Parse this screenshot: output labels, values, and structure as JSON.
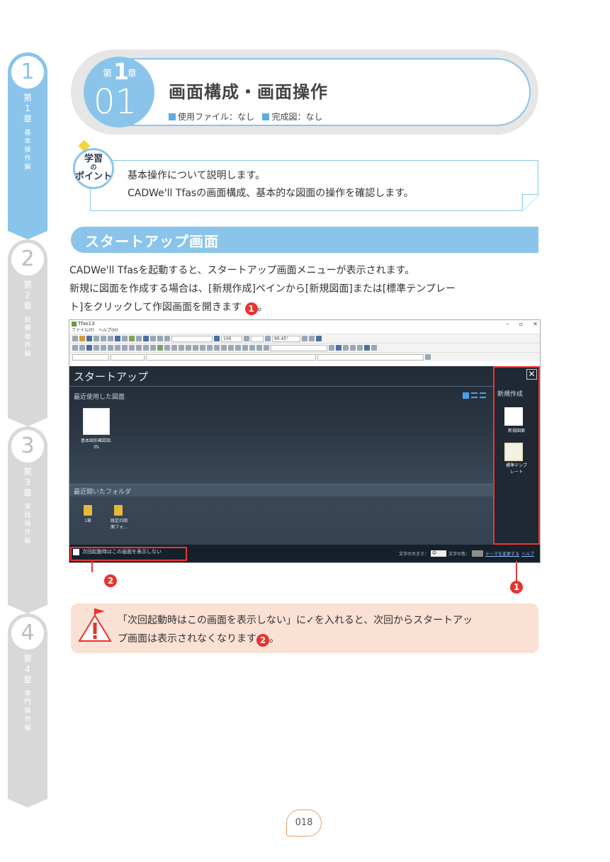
{
  "side_tabs": [
    {
      "num": "1",
      "chapter": [
        "第",
        "1",
        "章"
      ],
      "subtitle": [
        "基",
        "本",
        "操",
        "作",
        "編"
      ]
    },
    {
      "num": "2",
      "chapter": [
        "第",
        "2",
        "章"
      ],
      "subtitle": [
        "設",
        "備",
        "操",
        "作",
        "編"
      ]
    },
    {
      "num": "3",
      "chapter": [
        "第",
        "3",
        "章"
      ],
      "subtitle": [
        "実",
        "践",
        "操",
        "作",
        "編"
      ]
    },
    {
      "num": "4",
      "chapter": [
        "第",
        "4",
        "章"
      ],
      "subtitle": [
        "専",
        "門",
        "操",
        "作",
        "編"
      ]
    }
  ],
  "header": {
    "dai": "第",
    "chapter_num": "1",
    "sho": "章",
    "section_num": "01",
    "title": "画面構成・画面操作",
    "files_label": "使用ファイル：なし",
    "complete_label": "完成図：なし"
  },
  "point": {
    "badge_top": "学習",
    "badge_mid": "の",
    "badge_bottom": "ポイント",
    "line1": "基本操作について説明します。",
    "line2": "CADWe'll Tfasの画面構成、基本的な図面の操作を確認します。"
  },
  "section": {
    "title": "スタートアップ画面",
    "line1": "CADWe'll Tfasを起動すると、スタートアップ画面メニューが表示されます。",
    "line2": "新規に図面を作成する場合は、[新規作成]ペインから[新規図面]または[標準テンプレー",
    "line3": "ト]をクリックして作図画面を開きます",
    "marker": "1"
  },
  "screenshot": {
    "app_title": "Tfas13",
    "menu": "ファイル(F)　ヘルプ(H)",
    "zoom": "100",
    "angle": "90.45°",
    "startup_title": "スタートアップ",
    "recent_label": "最近使用した図面",
    "recent_file_line1": "基本図形確認図.",
    "recent_file_line2": "tfs",
    "folders_label": "最近開いたフォルダ",
    "folder1": "1章",
    "folder2_line1": "既定の図",
    "folder2_line2": "面フォ...",
    "new_label": "新規作成",
    "new_drawing": "新規図面",
    "template_line1": "標準テンプ",
    "template_line2": "レート",
    "close_glyph": "✕",
    "dont_show": "次回起動時はこの画面を表示しない",
    "font_size_label": "文字の大きさ：",
    "font_size_value": "中",
    "font_color_label": "文字の色：",
    "change_theme": "テーマを変更する",
    "help": "ヘルプ",
    "win_min": "–",
    "win_max": "▫",
    "win_close": "✕"
  },
  "callouts": {
    "one": "1",
    "two": "2"
  },
  "note": {
    "line1": "「次回起動時はこの画面を表示しない」に✓を入れると、次回からスタートアッ",
    "line2": "プ画面は表示されなくなります",
    "marker": "2",
    "end": "。"
  },
  "page_number": "018",
  "colors": {
    "accent": "#8ac4ea",
    "callout": "#e8332e",
    "note_bg": "#fbe0d4"
  }
}
